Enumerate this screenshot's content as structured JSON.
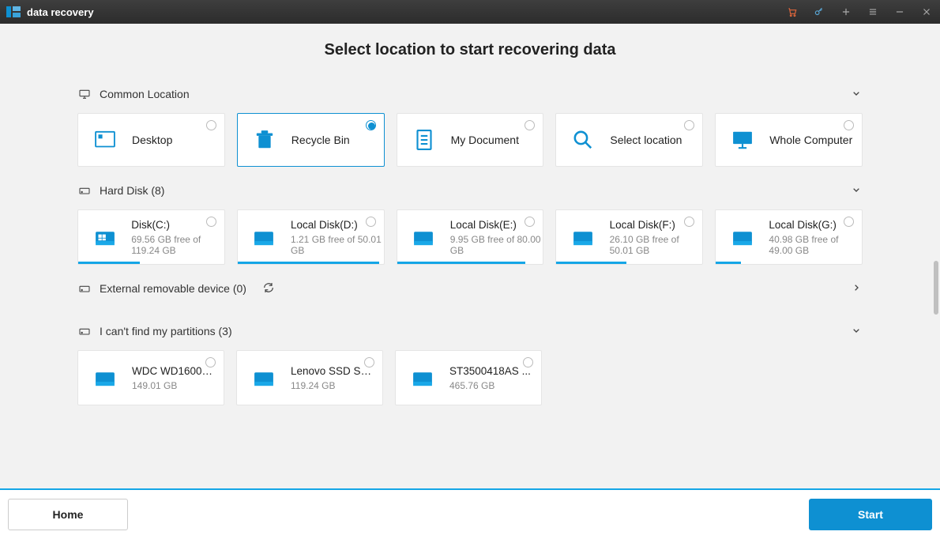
{
  "app": {
    "title": "data recovery"
  },
  "page": {
    "title": "Select location to start recovering data"
  },
  "sections": {
    "common": {
      "label": "Common Location",
      "items": [
        {
          "name": "Desktop"
        },
        {
          "name": "Recycle Bin"
        },
        {
          "name": "My Document"
        },
        {
          "name": "Select location"
        },
        {
          "name": "Whole Computer"
        }
      ],
      "selected_index": 1
    },
    "harddisk": {
      "label": "Hard Disk (8)",
      "items": [
        {
          "name": "Disk(C:)",
          "free": "69.56 GB  free of 119.24 GB",
          "pct": 42
        },
        {
          "name": "Local Disk(D:)",
          "free": "1.21 GB  free of 50.01 GB",
          "pct": 97
        },
        {
          "name": "Local Disk(E:)",
          "free": "9.95 GB  free of 80.00 GB",
          "pct": 88
        },
        {
          "name": "Local Disk(F:)",
          "free": "26.10 GB  free of 50.01 GB",
          "pct": 48
        },
        {
          "name": "Local Disk(G:)",
          "free": "40.98 GB  free of 49.00 GB",
          "pct": 17
        }
      ]
    },
    "external": {
      "label": "External removable device (0)"
    },
    "lost": {
      "label": "I can't find my partitions (3)",
      "items": [
        {
          "name": "WDC WD1600A...",
          "size": "149.01 GB"
        },
        {
          "name": "Lenovo SSD SL...",
          "size": "119.24 GB"
        },
        {
          "name": "ST3500418AS ...",
          "size": "465.76 GB"
        }
      ]
    }
  },
  "footer": {
    "home": "Home",
    "start": "Start"
  }
}
